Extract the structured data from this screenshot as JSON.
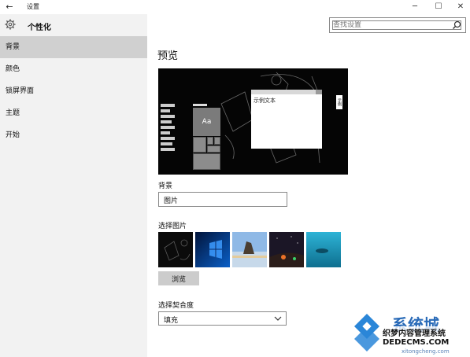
{
  "window": {
    "title": "设置",
    "back_glyph": "←",
    "min_glyph": "─",
    "max_glyph": "☐",
    "close_glyph": "✕"
  },
  "sidebar": {
    "title": "个性化",
    "items": [
      {
        "label": "背景",
        "active": true
      },
      {
        "label": "颜色",
        "active": false
      },
      {
        "label": "锁屏界面",
        "active": false
      },
      {
        "label": "主题",
        "active": false
      },
      {
        "label": "开始",
        "active": false
      }
    ]
  },
  "search": {
    "placeholder": "查找设置"
  },
  "main": {
    "preview_heading": "预览",
    "preview_sample_text": "示例文本",
    "preview_tile_text": "Aa",
    "preview_side_button": "示例",
    "background_label": "背景",
    "background_value": "图片",
    "choose_picture_label": "选择图片",
    "browse_label": "浏览",
    "fit_label": "选择契合度",
    "fit_value": "填充"
  },
  "watermark": {
    "brand": "系统城",
    "line1": "织梦内容管理系统",
    "line2": "DEDECMS.COM",
    "url": "xitongcheng.com"
  },
  "colors": {
    "accent": "#2a6bb8",
    "sidebar_bg": "#f2f2f2",
    "active_item_bg": "#d0d0d0",
    "preview_bg": "#050505"
  }
}
